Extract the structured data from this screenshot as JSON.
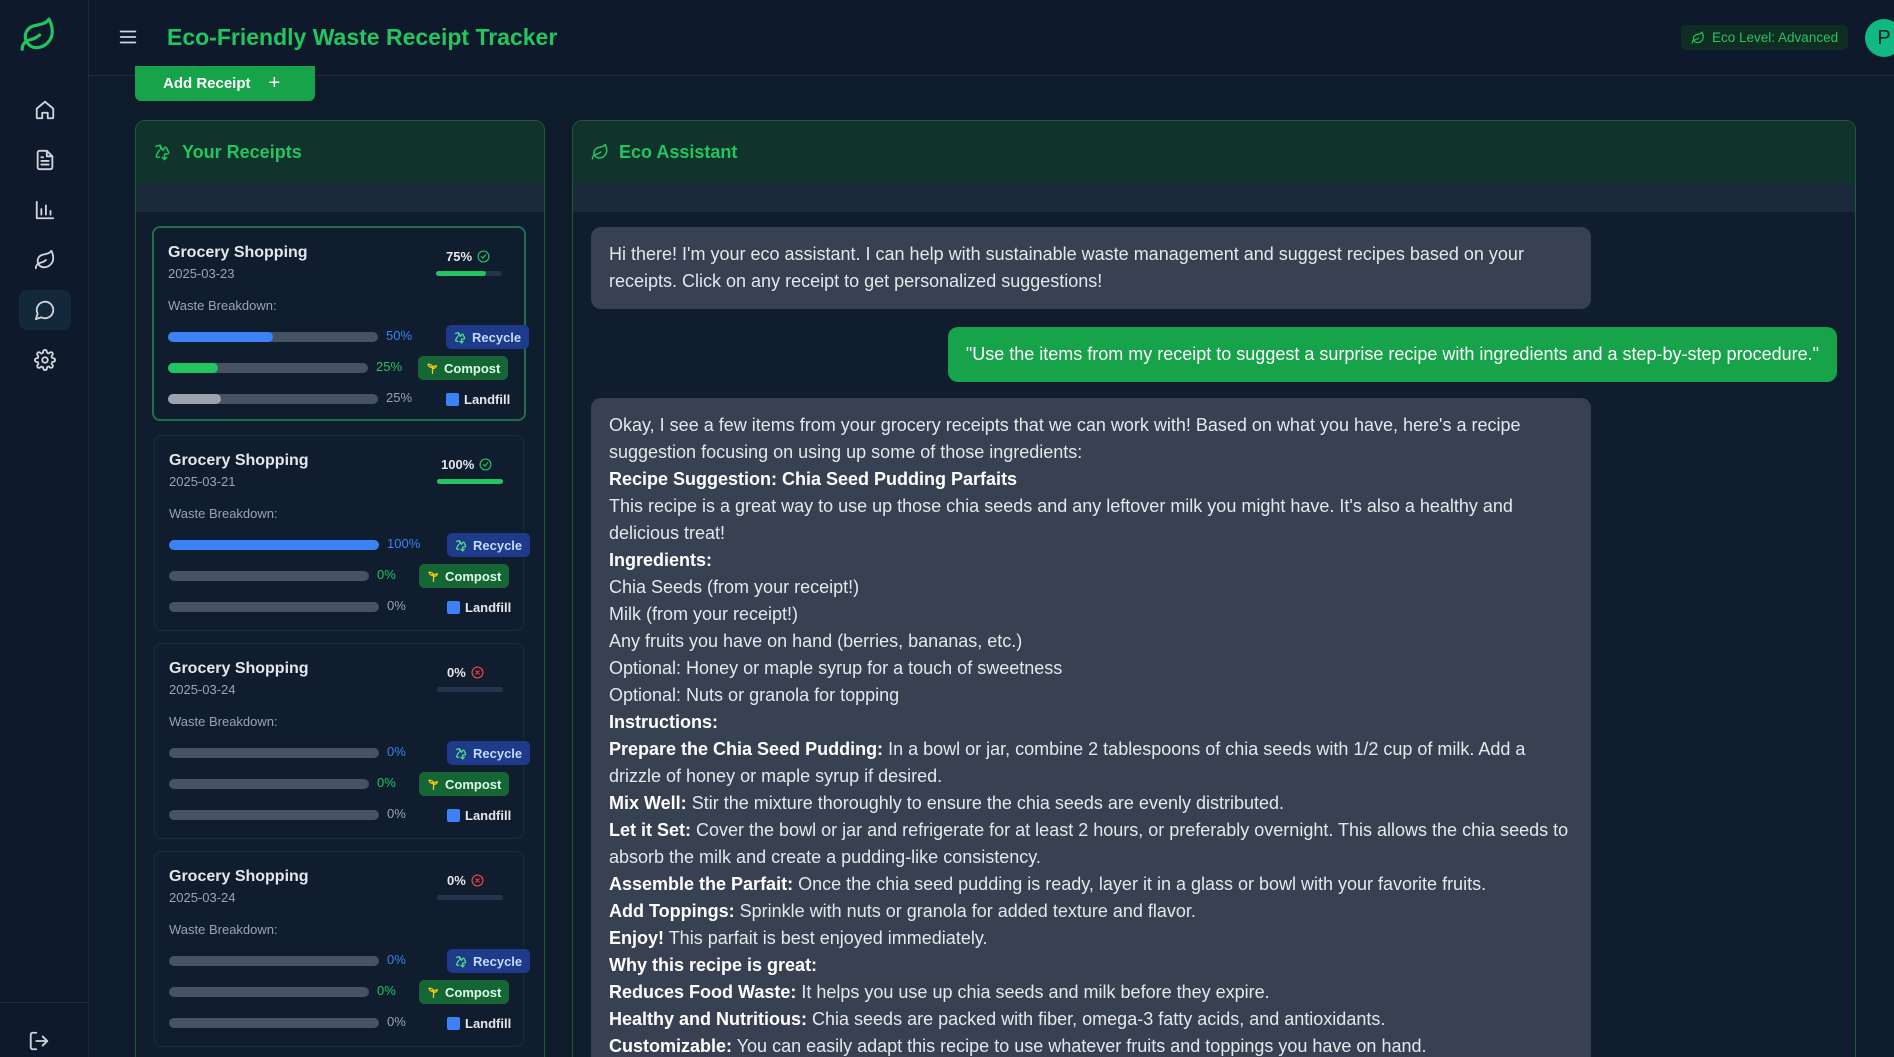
{
  "header": {
    "title": "Eco-Friendly Waste Receipt Tracker",
    "eco_level": "Eco Level: Advanced",
    "avatar_initial": "P"
  },
  "sidebar": {
    "items": [
      {
        "name": "home",
        "icon": "home-icon"
      },
      {
        "name": "receipts",
        "icon": "document-icon"
      },
      {
        "name": "analytics",
        "icon": "bar-chart-icon"
      },
      {
        "name": "eco",
        "icon": "leaf-icon"
      },
      {
        "name": "chat",
        "icon": "chat-bubble-icon",
        "active": true
      },
      {
        "name": "settings",
        "icon": "gear-icon"
      }
    ],
    "logout_icon": "logout-icon"
  },
  "actions": {
    "add_receipt": "Add Receipt",
    "add_symbol": "+"
  },
  "receipts_panel": {
    "title": "Your Receipts",
    "receipts": [
      {
        "title": "Grocery Shopping",
        "date": "2025-03-23",
        "score": "75%",
        "score_value": 0.75,
        "status": "check",
        "breakdown_label": "Waste Breakdown:",
        "recycle": "50%",
        "recycle_value": 0.5,
        "compost": "25%",
        "compost_value": 0.25,
        "landfill": "25%",
        "landfill_value": 0.25
      },
      {
        "title": "Grocery Shopping",
        "date": "2025-03-21",
        "score": "100%",
        "score_value": 1.0,
        "status": "check",
        "breakdown_label": "Waste Breakdown:",
        "recycle": "100%",
        "recycle_value": 1.0,
        "compost": "0%",
        "compost_value": 0,
        "landfill": "0%",
        "landfill_value": 0
      },
      {
        "title": "Grocery Shopping",
        "date": "2025-03-24",
        "score": "0%",
        "score_value": 0,
        "status": "x",
        "breakdown_label": "Waste Breakdown:",
        "recycle": "0%",
        "recycle_value": 0,
        "compost": "0%",
        "compost_value": 0,
        "landfill": "0%",
        "landfill_value": 0
      },
      {
        "title": "Grocery Shopping",
        "date": "2025-03-24",
        "score": "0%",
        "score_value": 0,
        "status": "x",
        "breakdown_label": "Waste Breakdown:",
        "recycle": "0%",
        "recycle_value": 0,
        "compost": "0%",
        "compost_value": 0,
        "landfill": "0%",
        "landfill_value": 0
      }
    ],
    "tags": {
      "recycle": "Recycle",
      "compost": "Compost",
      "landfill": "Landfill"
    }
  },
  "assistant_panel": {
    "title": "Eco Assistant",
    "greeting": "Hi there! I'm your eco assistant. I can help with sustainable waste management and suggest recipes based on your receipts. Click on any receipt to get personalized suggestions!",
    "user_message": "\"Use the items from my receipt to suggest a surprise recipe with ingredients and a step-by-step procedure.\"",
    "reply": {
      "intro": "Okay, I see a few items from your grocery receipts that we can work with! Based on what you have, here's a recipe suggestion focusing on using up some of those ingredients:",
      "recipe_heading": "Recipe Suggestion: Chia Seed Pudding Parfaits",
      "recipe_desc": "This recipe is a great way to use up those chia seeds and any leftover milk you might have. It's also a healthy and delicious treat!",
      "ingredients_heading": "Ingredients:",
      "ingredients": [
        "Chia Seeds (from your receipt!)",
        "Milk (from your receipt!)",
        "Any fruits you have on hand (berries, bananas, etc.)",
        "Optional: Honey or maple syrup for a touch of sweetness",
        "Optional: Nuts or granola for topping"
      ],
      "instructions_heading": "Instructions:",
      "steps": [
        {
          "label": "Prepare the Chia Seed Pudding:",
          "text": " In a bowl or jar, combine 2 tablespoons of chia seeds with 1/2 cup of milk. Add a drizzle of honey or maple syrup if desired."
        },
        {
          "label": "Mix Well:",
          "text": " Stir the mixture thoroughly to ensure the chia seeds are evenly distributed."
        },
        {
          "label": "Let it Set:",
          "text": " Cover the bowl or jar and refrigerate for at least 2 hours, or preferably overnight. This allows the chia seeds to absorb the milk and create a pudding-like consistency."
        },
        {
          "label": "Assemble the Parfait:",
          "text": " Once the chia seed pudding is ready, layer it in a glass or bowl with your favorite fruits."
        },
        {
          "label": "Add Toppings:",
          "text": " Sprinkle with nuts or granola for added texture and flavor."
        },
        {
          "label": "Enjoy!",
          "text": " This parfait is best enjoyed immediately."
        }
      ],
      "why_heading": "Why this recipe is great:",
      "reasons": [
        {
          "label": "Reduces Food Waste:",
          "text": " It helps you use up chia seeds and milk before they expire."
        },
        {
          "label": "Healthy and Nutritious:",
          "text": " Chia seeds are packed with fiber, omega-3 fatty acids, and antioxidants."
        },
        {
          "label": "Customizable:",
          "text": " You can easily adapt this recipe to use whatever fruits and toppings you have on hand."
        }
      ]
    }
  },
  "colors": {
    "background": "#0d1b2a",
    "accent": "#22c55e",
    "recycle": "#3b82f6",
    "compost": "#22c55e",
    "landfill": "#9ca3af"
  }
}
